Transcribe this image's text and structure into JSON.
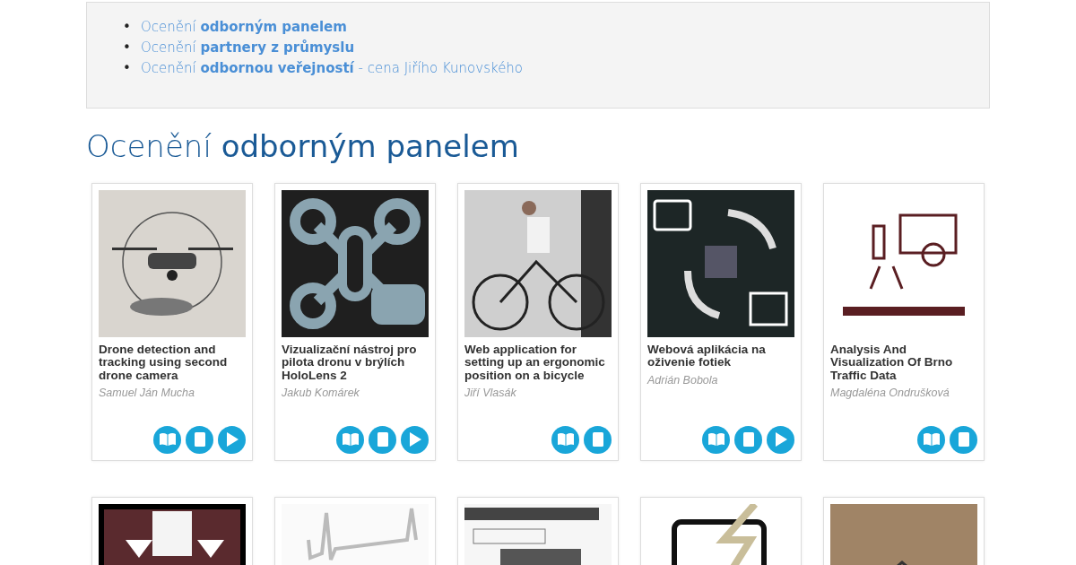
{
  "nav_links": [
    {
      "marker": "•",
      "text": "Ocenění **odborným panelem**"
    },
    {
      "marker": "•",
      "text": "Ocenění **partnery z průmyslu**"
    },
    {
      "marker": "•",
      "text": "Ocenění **odbornou veřejností** - cena Jiřího Kunovského"
    }
  ],
  "section_title": "Ocenění **odborným panelem**",
  "projects": [
    {
      "kind": "full",
      "title": "Drone detection and tracking using second drone camera",
      "author": "Samuel Ján Mucha",
      "actions": [
        {
          "kind": "read"
        },
        {
          "kind": "document"
        },
        {
          "kind": "play"
        }
      ]
    },
    {
      "kind": "full",
      "title": "Vizualizační nástroj pro pilota dronu v brýlích HoloLens 2",
      "author": "Jakub Komárek",
      "actions": [
        {
          "kind": "read"
        },
        {
          "kind": "document"
        },
        {
          "kind": "play"
        }
      ]
    },
    {
      "kind": "full",
      "title": "Web application for setting up an ergonomic position on a bicycle",
      "author": "Jiří Vlasák",
      "actions": [
        {
          "kind": "read"
        },
        {
          "kind": "document"
        }
      ]
    },
    {
      "kind": "full",
      "title": "Webová aplikácia na oživenie fotiek",
      "author": "Adrián Bobola",
      "actions": [
        {
          "kind": "read"
        },
        {
          "kind": "document"
        },
        {
          "kind": "play"
        }
      ]
    },
    {
      "kind": "full",
      "title": "Analysis And Visualization Of Brno Traffic Data",
      "author": "Magdaléna Ondrušková",
      "actions": [
        {
          "kind": "read"
        },
        {
          "kind": "document"
        }
      ]
    },
    {
      "kind": "cut"
    },
    {
      "kind": "cut"
    },
    {
      "kind": "cut"
    },
    {
      "kind": "cut"
    },
    {
      "kind": "cut"
    }
  ]
}
